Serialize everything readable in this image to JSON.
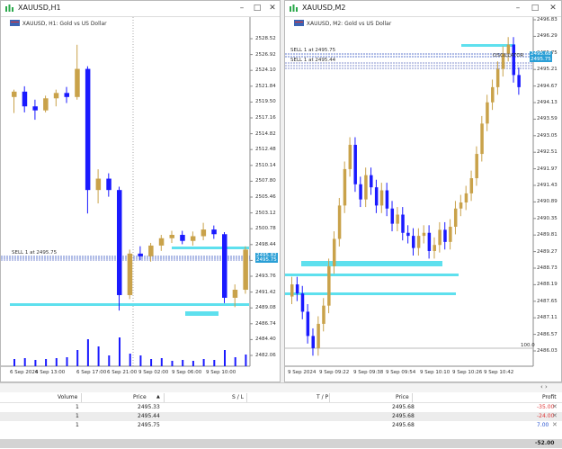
{
  "windows": [
    {
      "title": "XAUUSD,H1",
      "symbol_info": "XAUUSD, H1:  Gold vs US Dollar",
      "price_axis": [
        "2528.52",
        "2526.92",
        "2524.10",
        "2521.84",
        "2519.50",
        "2517.16",
        "2514.82",
        "2512.48",
        "2510.14",
        "2507.80",
        "2505.46",
        "2503.12",
        "2500.78",
        "2498.44",
        "2496.10",
        "2493.76",
        "2491.42",
        "2489.08",
        "2486.74",
        "2484.40",
        "2482.06"
      ],
      "time_axis": [
        "6 Sep 2024",
        "6 Sep 13:00",
        "6 Sep 17:00",
        "6 Sep 21:00",
        "9 Sep 02:00",
        "9 Sep 06:00",
        "9 Sep 10:00"
      ],
      "order_labels": [
        "SELL 1 at 2495.75"
      ],
      "price_tags": [
        "2495.82",
        "2495.75"
      ],
      "candles": [
        {
          "o": 2518.4,
          "h": 2519.5,
          "l": 2516.0,
          "c": 2519.2
        },
        {
          "o": 2519.2,
          "h": 2520.0,
          "l": 2516.1,
          "c": 2517.0
        },
        {
          "o": 2517.0,
          "h": 2518.0,
          "l": 2515.0,
          "c": 2516.4
        },
        {
          "o": 2516.4,
          "h": 2518.6,
          "l": 2516.1,
          "c": 2518.2
        },
        {
          "o": 2518.2,
          "h": 2519.5,
          "l": 2517.0,
          "c": 2519.0
        },
        {
          "o": 2519.0,
          "h": 2519.9,
          "l": 2517.5,
          "c": 2518.4
        },
        {
          "o": 2518.4,
          "h": 2526.2,
          "l": 2518.0,
          "c": 2522.6
        },
        {
          "o": 2522.6,
          "h": 2523.0,
          "l": 2501.0,
          "c": 2504.5
        },
        {
          "o": 2504.5,
          "h": 2507.6,
          "l": 2502.5,
          "c": 2506.2
        },
        {
          "o": 2506.2,
          "h": 2507.0,
          "l": 2503.5,
          "c": 2504.5
        },
        {
          "o": 2504.5,
          "h": 2505.0,
          "l": 2486.5,
          "c": 2488.8
        },
        {
          "o": 2488.8,
          "h": 2495.6,
          "l": 2488.2,
          "c": 2495.0
        },
        {
          "o": 2495.0,
          "h": 2496.1,
          "l": 2494.0,
          "c": 2494.6
        },
        {
          "o": 2494.6,
          "h": 2496.6,
          "l": 2493.8,
          "c": 2496.2
        },
        {
          "o": 2496.2,
          "h": 2497.8,
          "l": 2495.4,
          "c": 2497.3
        },
        {
          "o": 2497.3,
          "h": 2498.4,
          "l": 2496.6,
          "c": 2497.8
        },
        {
          "o": 2497.8,
          "h": 2498.4,
          "l": 2496.4,
          "c": 2496.9
        },
        {
          "o": 2496.9,
          "h": 2498.3,
          "l": 2496.2,
          "c": 2497.6
        },
        {
          "o": 2497.6,
          "h": 2499.6,
          "l": 2497.0,
          "c": 2498.6
        },
        {
          "o": 2498.6,
          "h": 2499.2,
          "l": 2497.2,
          "c": 2497.9
        },
        {
          "o": 2497.9,
          "h": 2498.2,
          "l": 2487.6,
          "c": 2488.4
        },
        {
          "o": 2488.4,
          "h": 2490.4,
          "l": 2487.0,
          "c": 2489.6
        },
        {
          "o": 2489.6,
          "h": 2496.1,
          "l": 2489.0,
          "c": 2495.6
        }
      ],
      "volumes": [
        8,
        9,
        7,
        8,
        9,
        10,
        18,
        30,
        22,
        12,
        32,
        14,
        12,
        8,
        9,
        6,
        7,
        6,
        8,
        7,
        18,
        10,
        13
      ]
    },
    {
      "title": "XAUUSD,M2",
      "symbol_info": "XAUUSD, M2:  Gold vs US Dollar",
      "price_axis": [
        "2496.83",
        "2496.29",
        "2495.75",
        "2495.21",
        "2494.67",
        "2494.13",
        "2493.59",
        "2493.05",
        "2492.51",
        "2491.97",
        "2491.43",
        "2490.89",
        "2490.35",
        "2489.81",
        "2489.27",
        "2488.73",
        "2488.19",
        "2487.65",
        "2487.11",
        "2486.57",
        "2486.03"
      ],
      "time_axis": [
        "9 Sep 2024",
        "9 Sep 09:22",
        "9 Sep 09:38",
        "9 Sep 09:54",
        "9 Sep 10:10",
        "9 Sep 10:26",
        "9 Sep 10:42"
      ],
      "order_labels": [
        "SELL 1 at 2495.75",
        "SELL 1 at 2495.44",
        "OSCILLATOR"
      ],
      "price_tags": [
        "2495.68",
        "2495.75"
      ],
      "volume_label": "100.0",
      "first_candle_index": 0,
      "candle_count": 44
    }
  ],
  "trade_table": {
    "headers": [
      "Volume",
      "Price",
      "S / L",
      "T / P",
      "Price",
      "Profit"
    ],
    "rows": [
      {
        "volume": "1",
        "price": "2495.33",
        "sl": "",
        "tp": "",
        "cur": "2495.68",
        "profit": "-35.00"
      },
      {
        "volume": "1",
        "price": "2495.44",
        "sl": "",
        "tp": "",
        "cur": "2495.68",
        "profit": "-24.00"
      },
      {
        "volume": "1",
        "price": "2495.75",
        "sl": "",
        "tp": "",
        "cur": "2495.68",
        "profit": "7.00"
      }
    ],
    "total": "-52.00",
    "nav": "‹ ›"
  },
  "colors": {
    "bull": "#c9a24a",
    "bear": "#1a1aff",
    "cyan": "#5ee0ee",
    "order": "#3050c0"
  }
}
